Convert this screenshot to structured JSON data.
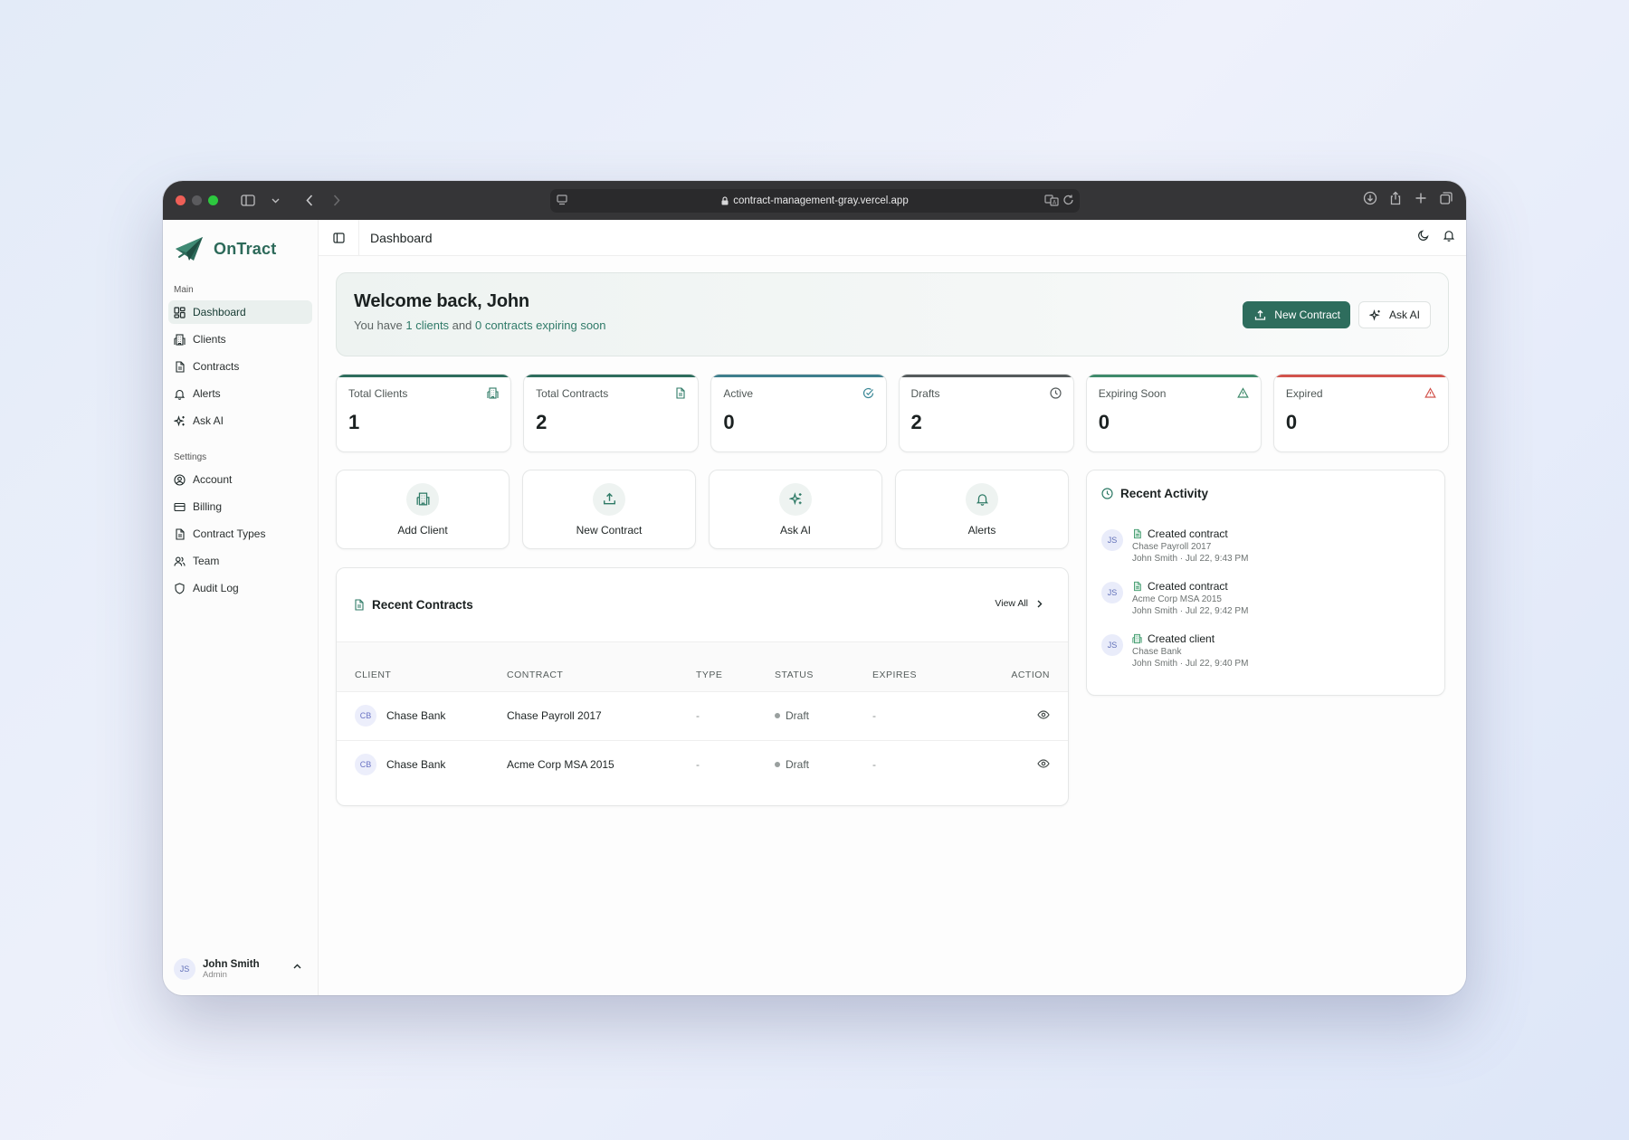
{
  "browser": {
    "url": "contract-management-gray.vercel.app"
  },
  "sidebar": {
    "brand": "OnTract",
    "main_label": "Main",
    "main_items": [
      {
        "label": "Dashboard",
        "icon": "dashboard-icon",
        "active": true
      },
      {
        "label": "Clients",
        "icon": "building-icon"
      },
      {
        "label": "Contracts",
        "icon": "document-icon"
      },
      {
        "label": "Alerts",
        "icon": "bell-icon"
      },
      {
        "label": "Ask AI",
        "icon": "sparkle-icon"
      }
    ],
    "settings_label": "Settings",
    "settings_items": [
      {
        "label": "Account",
        "icon": "user-circle-icon"
      },
      {
        "label": "Billing",
        "icon": "credit-card-icon"
      },
      {
        "label": "Contract Types",
        "icon": "document-icon"
      },
      {
        "label": "Team",
        "icon": "users-icon"
      },
      {
        "label": "Audit Log",
        "icon": "shield-icon"
      }
    ],
    "user": {
      "initials": "JS",
      "name": "John Smith",
      "role": "Admin"
    }
  },
  "topbar": {
    "title": "Dashboard"
  },
  "welcome": {
    "title": "Welcome back, John",
    "prefix": "You have ",
    "clients_text": "1 clients",
    "middle": " and ",
    "expiring_text": "0 contracts expiring soon",
    "new_contract_label": "New Contract",
    "ask_ai_label": "Ask AI"
  },
  "stats": [
    {
      "label": "Total Clients",
      "value": "1",
      "icon": "building-icon",
      "accent": "#2e6d5d",
      "icon_color": "#2e7a66"
    },
    {
      "label": "Total Contracts",
      "value": "2",
      "icon": "document-icon",
      "accent": "#2e6d5d",
      "icon_color": "#2e7a66"
    },
    {
      "label": "Active",
      "value": "0",
      "icon": "check-circle-icon",
      "accent": "#3f7f8d",
      "icon_color": "#3a8796"
    },
    {
      "label": "Drafts",
      "value": "2",
      "icon": "clock-icon",
      "accent": "#555b5c",
      "icon_color": "#555b5c"
    },
    {
      "label": "Expiring Soon",
      "value": "0",
      "icon": "warning-icon",
      "accent": "#3f8a6b",
      "icon_color": "#3f8a6b"
    },
    {
      "label": "Expired",
      "value": "0",
      "icon": "alert-triangle-icon",
      "accent": "#d2534c",
      "icon_color": "#d2534c"
    }
  ],
  "quick_actions": [
    {
      "label": "Add Client",
      "icon": "building-icon"
    },
    {
      "label": "New Contract",
      "icon": "upload-icon"
    },
    {
      "label": "Ask AI",
      "icon": "sparkle-icon"
    },
    {
      "label": "Alerts",
      "icon": "bell-icon"
    }
  ],
  "recent_contracts": {
    "title": "Recent Contracts",
    "view_all": "View All",
    "columns": [
      "CLIENT",
      "CONTRACT",
      "TYPE",
      "STATUS",
      "EXPIRES",
      "ACTION"
    ],
    "rows": [
      {
        "initials": "CB",
        "client": "Chase Bank",
        "contract": "Chase Payroll 2017",
        "type": "-",
        "status": "Draft",
        "expires": "-"
      },
      {
        "initials": "CB",
        "client": "Chase Bank",
        "contract": "Acme Corp MSA 2015",
        "type": "-",
        "status": "Draft",
        "expires": "-"
      }
    ]
  },
  "recent_activity": {
    "title": "Recent Activity",
    "items": [
      {
        "initials": "JS",
        "action": "Created contract",
        "target": "Chase Payroll 2017",
        "meta": "John Smith · Jul 22, 9:43 PM",
        "icon": "document-icon"
      },
      {
        "initials": "JS",
        "action": "Created contract",
        "target": "Acme Corp MSA 2015",
        "meta": "John Smith · Jul 22, 9:42 PM",
        "icon": "document-icon"
      },
      {
        "initials": "JS",
        "action": "Created client",
        "target": "Chase Bank",
        "meta": "John Smith · Jul 22, 9:40 PM",
        "icon": "building-icon"
      }
    ]
  },
  "colors": {
    "brand": "#2d6a5a",
    "primary_button": "#2e6d5d",
    "highlight_text": "#2f7a68"
  }
}
